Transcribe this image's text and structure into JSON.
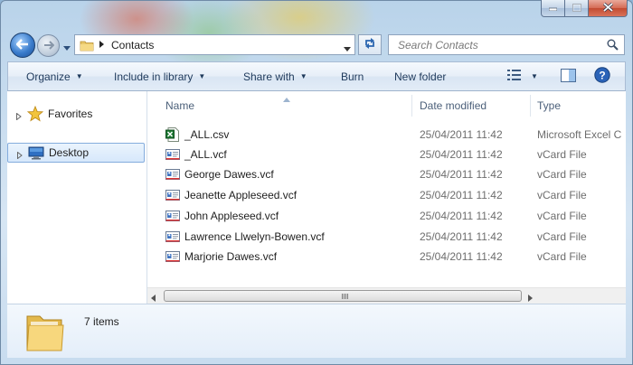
{
  "window": {
    "caption_buttons": {
      "minimize_icon": "minimize-icon",
      "maximize_icon": "maximize-icon",
      "close_icon": "close-icon"
    }
  },
  "address": {
    "breadcrumb": [
      "Contacts"
    ],
    "search_placeholder": "Search Contacts"
  },
  "toolbar": {
    "organize": "Organize",
    "include_in_library": "Include in library",
    "share_with": "Share with",
    "burn": "Burn",
    "new_folder": "New folder",
    "icons": [
      "view-options-icon",
      "preview-pane-icon",
      "help-icon"
    ]
  },
  "navigation": {
    "items": [
      {
        "label": "Favorites",
        "icon": "star-icon"
      },
      {
        "label": "Desktop",
        "icon": "desktop-icon",
        "selected": true
      }
    ]
  },
  "columns": {
    "name": "Name",
    "date": "Date modified",
    "type": "Type"
  },
  "files": [
    {
      "name": "_ALL.csv",
      "date": "25/04/2011 11:42",
      "type": "Microsoft Excel C",
      "icon": "excel-file-icon"
    },
    {
      "name": "_ALL.vcf",
      "date": "25/04/2011 11:42",
      "type": "vCard File",
      "icon": "vcard-file-icon"
    },
    {
      "name": "George Dawes.vcf",
      "date": "25/04/2011 11:42",
      "type": "vCard File",
      "icon": "vcard-file-icon"
    },
    {
      "name": "Jeanette Appleseed.vcf",
      "date": "25/04/2011 11:42",
      "type": "vCard File",
      "icon": "vcard-file-icon"
    },
    {
      "name": "John Appleseed.vcf",
      "date": "25/04/2011 11:42",
      "type": "vCard File",
      "icon": "vcard-file-icon"
    },
    {
      "name": "Lawrence Llwelyn-Bowen.vcf",
      "date": "25/04/2011 11:42",
      "type": "vCard File",
      "icon": "vcard-file-icon"
    },
    {
      "name": "Marjorie Dawes.vcf",
      "date": "25/04/2011 11:42",
      "type": "vCard File",
      "icon": "vcard-file-icon"
    }
  ],
  "details": {
    "item_count": "7 items",
    "icon": "folder-icon"
  },
  "colors": {
    "accent": "#3a7ccc",
    "selection": "#d7e8fb",
    "command_text": "#1e395b"
  }
}
